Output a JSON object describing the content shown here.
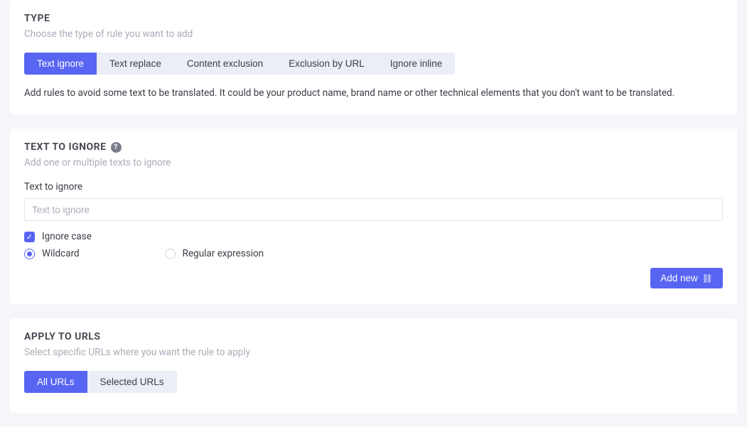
{
  "type_section": {
    "title": "TYPE",
    "subtitle": "Choose the type of rule you want to add",
    "tabs": [
      {
        "label": "Text ignore",
        "active": true
      },
      {
        "label": "Text replace",
        "active": false
      },
      {
        "label": "Content exclusion",
        "active": false
      },
      {
        "label": "Exclusion by URL",
        "active": false
      },
      {
        "label": "Ignore inline",
        "active": false
      }
    ],
    "description": "Add rules to avoid some text to be translated. It could be your product name, brand name or other technical elements that you don't want to be translated."
  },
  "text_to_ignore": {
    "title": "TEXT TO IGNORE",
    "subtitle": "Add one or multiple texts to ignore",
    "field_label": "Text to ignore",
    "placeholder": "Text to ignore",
    "value": "",
    "ignore_case": {
      "label": "Ignore case",
      "checked": true
    },
    "mode": {
      "options": [
        {
          "label": "Wildcard",
          "selected": true
        },
        {
          "label": "Regular expression",
          "selected": false
        }
      ]
    },
    "add_button": "Add new"
  },
  "apply_urls": {
    "title": "APPLY TO URLS",
    "subtitle": "Select specific URLs where you want the rule to apply",
    "tabs": [
      {
        "label": "All URLs",
        "active": true
      },
      {
        "label": "Selected URLs",
        "active": false
      }
    ]
  }
}
